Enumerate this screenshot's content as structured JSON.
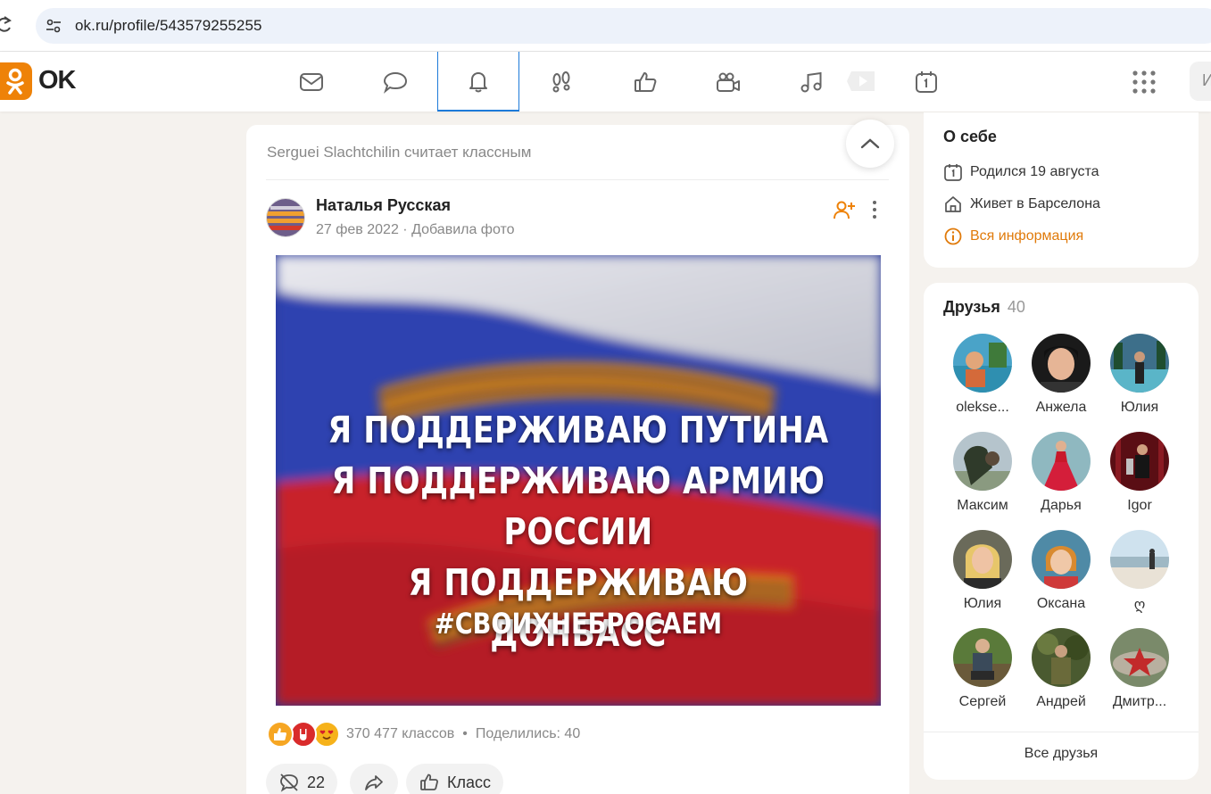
{
  "browser": {
    "url": "ok.ru/profile/543579255255"
  },
  "header": {
    "logo_text": "OK",
    "search_stub": "И"
  },
  "feed": {
    "liked_by": "Serguei Slachtchilin считает классным",
    "post": {
      "author": "Наталья Русская",
      "date": "27 фев 2022",
      "meta_separator": "·",
      "action": "Добавила фото",
      "image_lines": [
        "Я ПОДДЕРЖИВАЮ ПУТИНА",
        "Я ПОДДЕРЖИВАЮ АРМИЮ РОССИИ",
        "Я ПОДДЕРЖИВАЮ ДОНБАСС"
      ],
      "image_hashtag": "#СВОИХНЕБРОСАЕМ",
      "klass_count": "370 477 классов",
      "stats_separator": "•",
      "shared": "Поделились: 40",
      "comments_count": "22",
      "klass_label": "Класс"
    }
  },
  "about": {
    "title": "О себе",
    "birthday": "Родился 19 августа",
    "lives": "Живет в Барселона",
    "all_info": "Вся информация"
  },
  "friends": {
    "title": "Друзья",
    "count": "40",
    "items": [
      {
        "name": "olekse..."
      },
      {
        "name": "Анжела"
      },
      {
        "name": "Юлия"
      },
      {
        "name": "Максим"
      },
      {
        "name": "Дарья"
      },
      {
        "name": "Igor"
      },
      {
        "name": "Юлия"
      },
      {
        "name": "Оксана"
      },
      {
        "name": "ღ"
      },
      {
        "name": "Сергей"
      },
      {
        "name": "Андрей"
      },
      {
        "name": "Дмитр..."
      }
    ],
    "all_label": "Все друзья"
  },
  "colors": {
    "ok_orange": "#ee8208",
    "active_blue": "#1d7ad9",
    "link_orange": "#e07a0a"
  }
}
